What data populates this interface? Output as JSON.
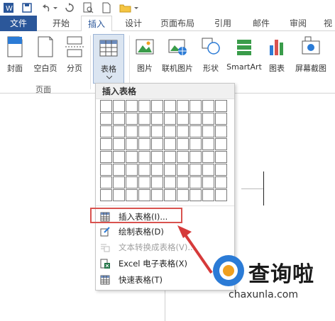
{
  "tabs": {
    "file": "文件",
    "items": [
      "开始",
      "插入",
      "设计",
      "页面布局",
      "引用",
      "邮件",
      "审阅",
      "视"
    ]
  },
  "ribbon": {
    "cover": "封面",
    "blank_page": "空白页",
    "page_break": "分页",
    "table": "表格",
    "picture": "图片",
    "online_picture": "联机图片",
    "shapes": "形状",
    "smartart": "SmartArt",
    "chart": "图表",
    "screenshot": "屏幕截图",
    "group_pages": "页面"
  },
  "dropdown": {
    "title": "插入表格",
    "items": [
      {
        "label": "插入表格(I)..."
      },
      {
        "label": "绘制表格(D)"
      },
      {
        "label": "文本转换成表格(V)..."
      },
      {
        "label": "Excel 电子表格(X)"
      },
      {
        "label": "快速表格(T)"
      }
    ]
  },
  "watermark": {
    "name": "查询啦",
    "url": "chaxunla.com"
  },
  "colors": {
    "accent": "#2b579a",
    "highlight_border": "#d9534f",
    "arrow": "#d63a3a"
  }
}
